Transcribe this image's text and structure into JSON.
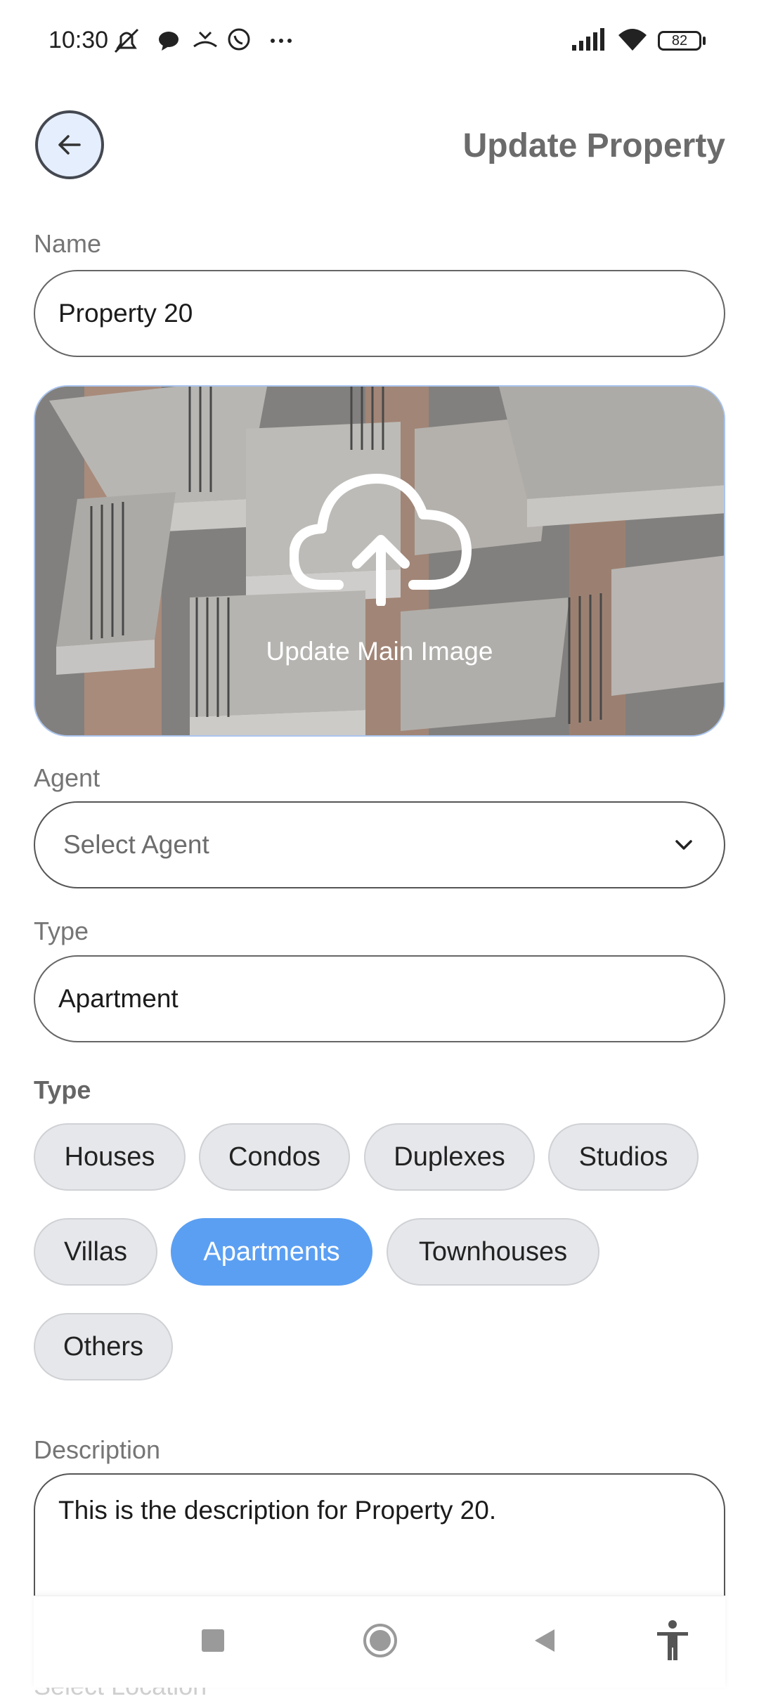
{
  "status_bar": {
    "time": "10:30",
    "battery": "82"
  },
  "header": {
    "title": "Update Property"
  },
  "form": {
    "name_label": "Name",
    "name_value": "Property 20",
    "image_label": "Update Main Image",
    "agent_label": "Agent",
    "agent_placeholder": "Select Agent",
    "type_label": "Type",
    "type_value": "Apartment",
    "type_chips_title": "Type",
    "type_chips": [
      "Houses",
      "Condos",
      "Duplexes",
      "Studios",
      "Villas",
      "Apartments",
      "Townhouses",
      "Others"
    ],
    "selected_chip": "Apartments",
    "description_label": "Description",
    "description_value": "This is the description for Property 20.",
    "next_label_partial": "Select Location"
  },
  "icons": {
    "back": "arrow-left-icon",
    "upload": "cloud-upload-icon",
    "dropdown": "chevron-down-icon",
    "nav": [
      "square-icon",
      "circle-icon",
      "triangle-back-icon",
      "accessibility-icon"
    ]
  },
  "colors": {
    "accent": "#5b9ff2",
    "chip_bg": "#e6e7ea",
    "back_button_bg": "#e5eefc"
  }
}
